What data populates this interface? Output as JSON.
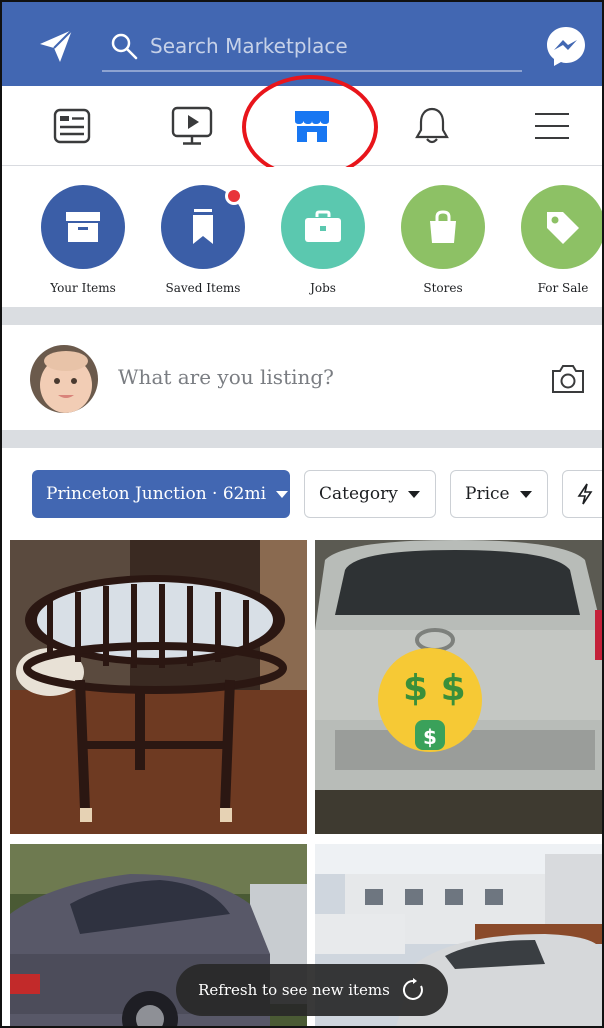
{
  "header": {
    "search_placeholder": "Search Marketplace",
    "icons": [
      "send-icon",
      "search-icon",
      "messenger-icon"
    ]
  },
  "nav": {
    "tabs": [
      {
        "name": "news-feed",
        "icon": "news-feed-icon"
      },
      {
        "name": "watch",
        "icon": "watch-video-icon"
      },
      {
        "name": "marketplace",
        "icon": "marketplace-store-icon",
        "active": true
      },
      {
        "name": "notifications",
        "icon": "bell-icon"
      },
      {
        "name": "menu",
        "icon": "menu-icon"
      }
    ],
    "active_color": "#1877f2",
    "annotation_color": "#e8151b"
  },
  "shortcuts": {
    "items": [
      {
        "label": "Your Items",
        "color": "#3b5ea7",
        "icon": "box-icon"
      },
      {
        "label": "Saved Items",
        "color": "#3b5ea7",
        "icon": "bookmark-icon",
        "badge": true
      },
      {
        "label": "Jobs",
        "color": "#5bc8af",
        "icon": "briefcase-icon"
      },
      {
        "label": "Stores",
        "color": "#8dc165",
        "icon": "shopping-bag-icon"
      },
      {
        "label": "For Sale",
        "color": "#8dc165",
        "icon": "price-tag-icon"
      }
    ]
  },
  "composer": {
    "prompt": "What are you listing?"
  },
  "filters": {
    "location": "Princeton Junction · 62mi",
    "category": "Category",
    "price": "Price"
  },
  "toast": {
    "text": "Refresh to see new items"
  },
  "colors": {
    "brand_blue": "#4267b2"
  }
}
